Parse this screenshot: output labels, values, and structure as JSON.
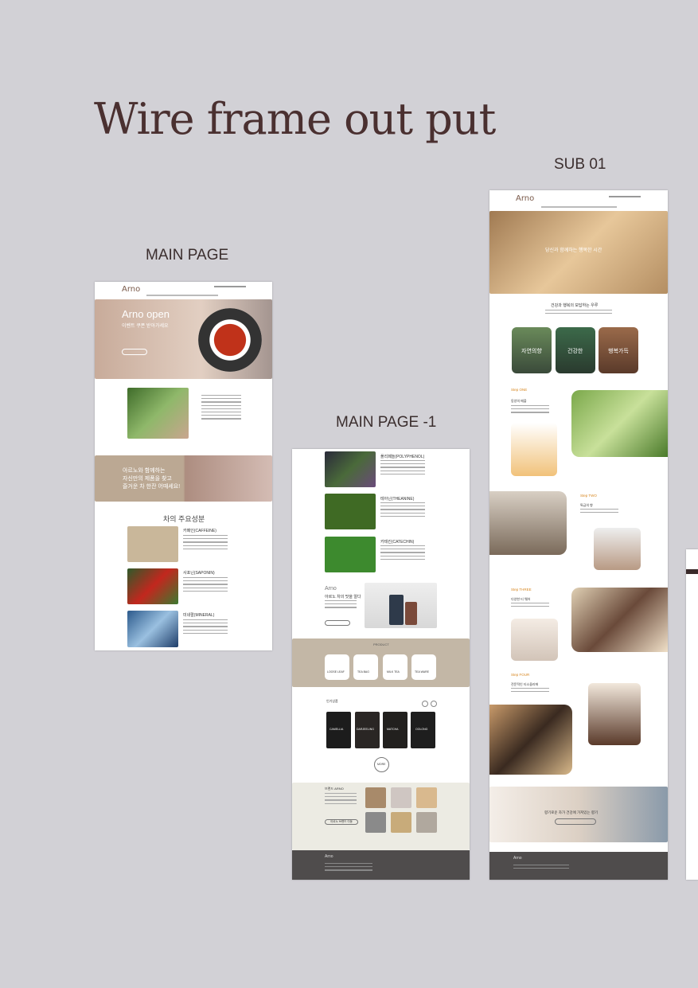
{
  "page_title": "Wire frame out put",
  "labels": {
    "main": "MAIN PAGE",
    "main1": "MAIN PAGE -1",
    "sub01": "SUB 01"
  },
  "main_page": {
    "logo": "Arno",
    "hero_title": "Arno open",
    "hero_sub": "이벤트 쿠폰 받아가세요",
    "banner_text_1": "아르노와 함께하는",
    "banner_text_2": "자신만의 제품을 찾고",
    "banner_text_3": "즐거운 차 한잔 어때세요!",
    "section_title": "차의 주요성분",
    "items": [
      "카페인(CAFFEINE)",
      "사포닌(SAPONIN)",
      "미네랄(MINERAL)"
    ]
  },
  "main_page_1": {
    "items": [
      "폴리페놀(POLYPHENOL)",
      "테아닌(THEANINE)",
      "카테킨(CATECHIN)"
    ],
    "promo_logo": "Arno",
    "promo_text": "아르노 차의 맛을 알다",
    "product_label": "PRODUCT",
    "categories": [
      "LOOSE LEAF",
      "TEA BAG",
      "MILK TEA",
      "TEA WARE"
    ],
    "popular_label": "인기상품",
    "products": [
      "CAMELLIA",
      "DARJEELING",
      "MATCHA",
      "OOLONG"
    ],
    "more_btn": "MORE",
    "brand_label": "브랜드 ARNO",
    "brand_btn": "아르노 브랜드 이동",
    "footer_logo": "Arno"
  },
  "sub01": {
    "logo": "Arno",
    "hero_text": "당신과 함께하는 행복한 시간",
    "intro_title": "건강과 행복의 보답하는 우루",
    "tiles": [
      "자연의향",
      "건강한",
      "행복가득"
    ],
    "steps": [
      {
        "label": "Step ONE",
        "title": "동양의 매플"
      },
      {
        "label": "Step TWO",
        "title": "특급의 향"
      },
      {
        "label": "Step THREE",
        "title": "다양한 티 웨어"
      },
      {
        "label": "Step FOUR",
        "title": "전문적인 티소믈리에"
      }
    ],
    "bottom_text": "향기로운 차가 건강에 가져있는 향기",
    "footer_logo": "Arno"
  }
}
